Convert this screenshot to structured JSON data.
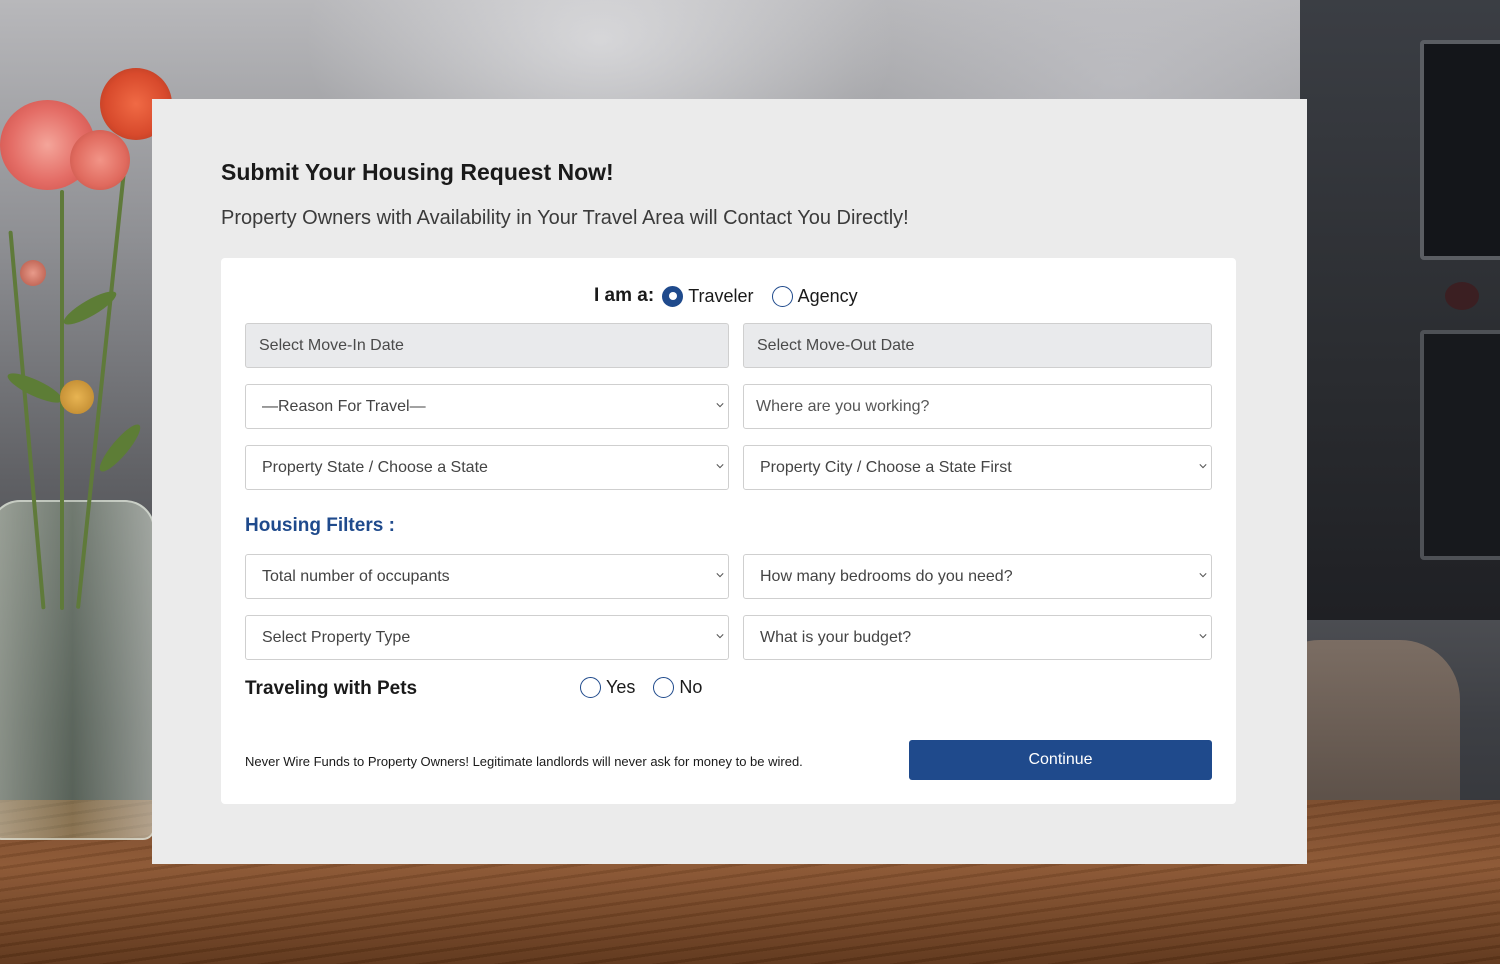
{
  "header": {
    "title": "Submit Your Housing Request Now!",
    "subtitle": "Property Owners with Availability in Your Travel Area will Contact You Directly!"
  },
  "form": {
    "user_type": {
      "label": "I am a:",
      "options": [
        {
          "label": "Traveler",
          "checked": true
        },
        {
          "label": "Agency",
          "checked": false
        }
      ]
    },
    "move_in": {
      "placeholder": "Select Move-In Date"
    },
    "move_out": {
      "placeholder": "Select Move-Out Date"
    },
    "reason": {
      "selected": "—Reason For Travel—"
    },
    "work_location": {
      "placeholder": "Where are you working?"
    },
    "state": {
      "selected": "Property State / Choose a State"
    },
    "city": {
      "selected": "Property City / Choose a State First"
    },
    "filters_heading": "Housing Filters :",
    "occupants": {
      "selected": "Total number of occupants"
    },
    "bedrooms": {
      "selected": "How many bedrooms do you need?"
    },
    "property_type": {
      "selected": "Select Property Type"
    },
    "budget": {
      "selected": "What is your budget?"
    },
    "pets": {
      "label": "Traveling with Pets",
      "options": [
        {
          "label": "Yes",
          "checked": false
        },
        {
          "label": "No",
          "checked": false
        }
      ]
    },
    "disclaimer": "Never Wire Funds to Property Owners! Legitimate landlords will never ask for money to be wired.",
    "submit_label": "Continue"
  },
  "colors": {
    "accent": "#1f4a8c",
    "panel_bg": "#ebebeb",
    "card_bg": "#ffffff"
  }
}
